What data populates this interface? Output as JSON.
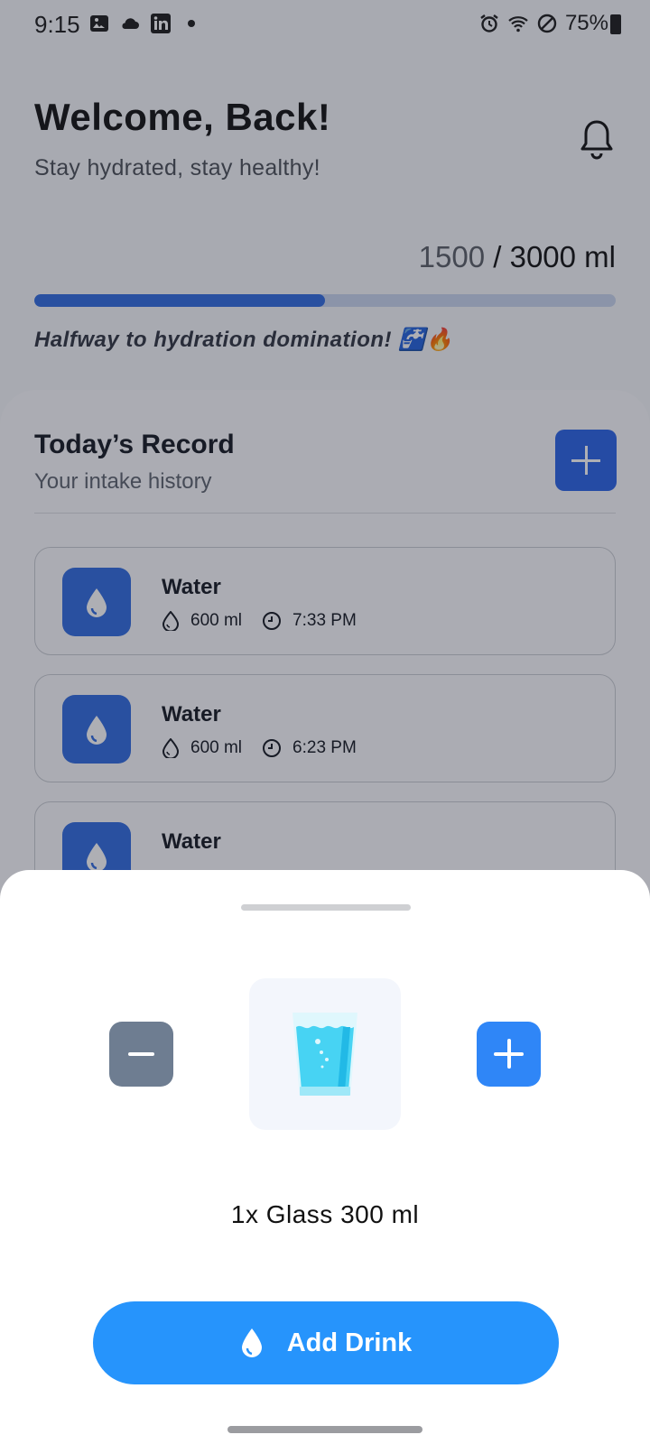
{
  "status_bar": {
    "time": "9:15",
    "battery": "75%",
    "icons_left": [
      "image-icon",
      "cloud-icon",
      "linkedin-icon",
      "dot-icon"
    ],
    "icons_right": [
      "alarm-icon",
      "wifi-icon",
      "do-not-disturb-icon",
      "battery-icon"
    ]
  },
  "header": {
    "title": "Welcome, Back!",
    "subtitle": "Stay hydrated, stay healthy!"
  },
  "progress": {
    "current": "1500",
    "separator": " / ",
    "goal": "3000 ml",
    "fraction": 0.5,
    "message": "Halfway to hydration domination! 🚰🔥"
  },
  "record": {
    "title": "Today’s Record",
    "subtitle": "Your intake history",
    "entries": [
      {
        "name": "Water",
        "amount": "600 ml",
        "time": "7:33 PM"
      },
      {
        "name": "Water",
        "amount": "600 ml",
        "time": "6:23 PM"
      },
      {
        "name": "Water"
      }
    ]
  },
  "sheet": {
    "selection_label": "1x Glass 300 ml",
    "add_button_label": "Add Drink"
  },
  "colors": {
    "primary": "#2f6be0",
    "accent": "#2694fc",
    "minus": "#6e7d91",
    "plus": "#2f86f7"
  }
}
